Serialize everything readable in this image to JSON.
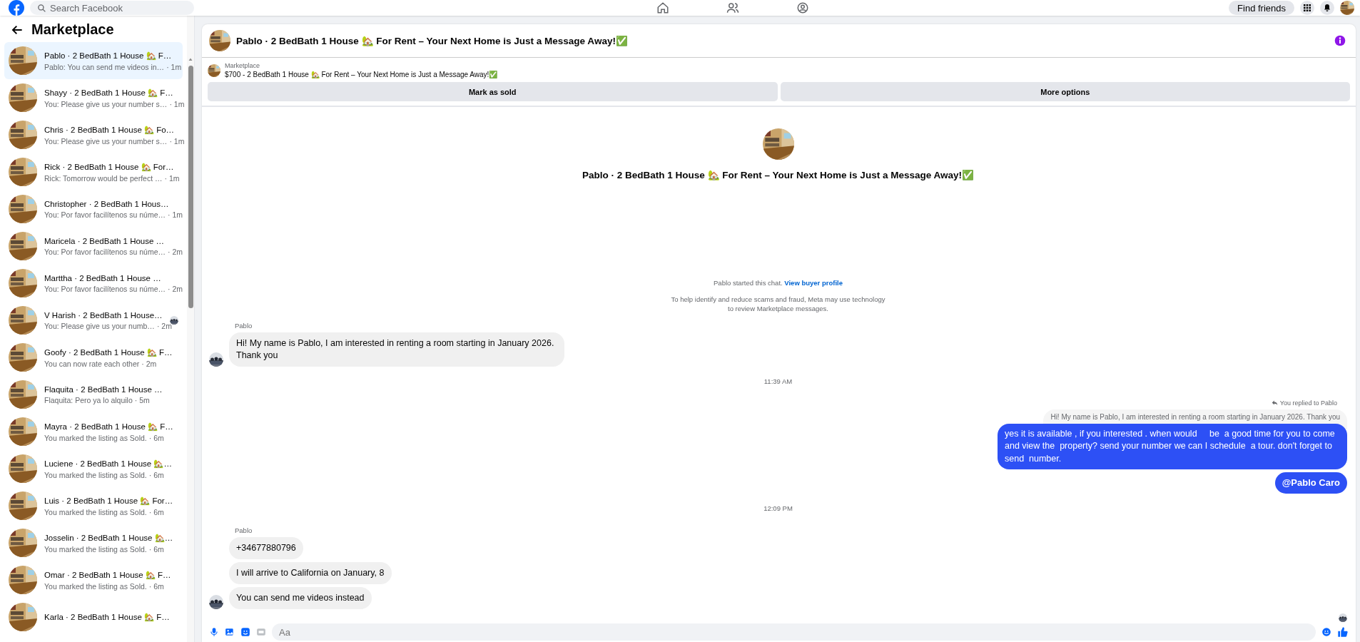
{
  "topbar": {
    "search": {
      "placeholder": "Search Facebook"
    },
    "find_friends": "Find friends"
  },
  "sidebar": {
    "title": "Marketplace",
    "conversations": [
      {
        "title": "Pablo · 2 BedBath 1 House 🏡 F…",
        "preview": "Pablo: You can send me videos in…",
        "time": "· 1m",
        "selected": true,
        "seen": false
      },
      {
        "title": "Shayy · 2 BedBath 1 House 🏡 F…",
        "preview": "You: Please give us your number s…",
        "time": "· 1m",
        "selected": false,
        "seen": false
      },
      {
        "title": "Chris · 2 BedBath 1 House 🏡 Fo…",
        "preview": "You: Please give us your number s…",
        "time": "· 1m",
        "selected": false,
        "seen": false
      },
      {
        "title": "Rick · 2 BedBath 1 House 🏡 For…",
        "preview": "Rick: Tomorrow would be perfect …",
        "time": "· 1m",
        "selected": false,
        "seen": false
      },
      {
        "title": "Christopher · 2 BedBath 1 Hous…",
        "preview": "You: Por favor facilítenos su núme…",
        "time": "· 1m",
        "selected": false,
        "seen": false
      },
      {
        "title": "Maricela · 2 BedBath 1 House …",
        "preview": "You: Por favor facilítenos su núme…",
        "time": "· 2m",
        "selected": false,
        "seen": false
      },
      {
        "title": "Marttha · 2 BedBath 1 House …",
        "preview": "You: Por favor facilítenos su núme…",
        "time": "· 2m",
        "selected": false,
        "seen": false
      },
      {
        "title": "V Harish · 2 BedBath 1 House…",
        "preview": "You: Please give us your numb…",
        "time": "· 2m",
        "selected": false,
        "seen": true
      },
      {
        "title": "Goofy · 2 BedBath 1 House 🏡 F…",
        "preview": "You can now rate each other",
        "time": "· 2m",
        "selected": false,
        "seen": false
      },
      {
        "title": "Flaquita · 2 BedBath 1 House …",
        "preview": "Flaquita: Pero ya lo alquilo",
        "time": "· 5m",
        "selected": false,
        "seen": false
      },
      {
        "title": "Mayra · 2 BedBath 1 House 🏡 F…",
        "preview": "You marked the listing as Sold.",
        "time": "· 6m",
        "selected": false,
        "seen": false
      },
      {
        "title": "Luciene · 2 BedBath 1 House 🏡…",
        "preview": "You marked the listing as Sold.",
        "time": "· 6m",
        "selected": false,
        "seen": false
      },
      {
        "title": "Luis · 2 BedBath 1 House 🏡 For…",
        "preview": "You marked the listing as Sold.",
        "time": "· 6m",
        "selected": false,
        "seen": false
      },
      {
        "title": "Josselin · 2 BedBath 1 House 🏡…",
        "preview": "You marked the listing as Sold.",
        "time": "· 6m",
        "selected": false,
        "seen": false
      },
      {
        "title": "Omar · 2 BedBath 1 House 🏡 F…",
        "preview": "You marked the listing as Sold.",
        "time": "· 6m",
        "selected": false,
        "seen": false
      },
      {
        "title": "Karla · 2 BedBath 1 House 🏡 F…",
        "selected": false,
        "seen": false
      }
    ]
  },
  "chat": {
    "title": "Pablo · 2 BedBath 1 House 🏡 For Rent – Your Next Home is Just a Message Away!✅",
    "listing": {
      "label": "Marketplace",
      "text": "$700 - 2 BedBath 1 House 🏡 For Rent – Your Next Home is Just a Message Away!✅",
      "buttons": [
        "Mark as sold",
        "More options"
      ]
    },
    "intro_title": "Pablo · 2 BedBath 1 House 🏡 For Rent – Your Next Home is Just a Message Away!✅",
    "messages": [
      {
        "kind": "system",
        "text": "Pablo started this chat.",
        "link": "View buyer profile"
      },
      {
        "kind": "notice",
        "text": "To help identify and reduce scams and fraud, Meta may use technology to review Marketplace messages."
      },
      {
        "kind": "incoming",
        "sender": "Pablo",
        "bubbles": [
          "Hi! My name is Pablo, I am interested in renting a room starting in January 2026. Thank you"
        ]
      },
      {
        "kind": "time",
        "text": "11:39 AM"
      },
      {
        "kind": "outgoing",
        "reply_label": "You replied to Pablo",
        "quoted": "Hi! My name is Pablo, I am interested in renting a room starting in January 2026. Thank you",
        "bubbles": [
          "yes it is available , if you interested . when would     be  a good time for you to come and view the  property? send your number we can I schedule  a tour. don't forget to send  number.",
          "@Pablo Caro"
        ]
      },
      {
        "kind": "time",
        "text": "12:09 PM"
      },
      {
        "kind": "incoming",
        "sender": "Pablo",
        "bubbles": [
          "+34677880796",
          "I will arrive to California on January, 8",
          "You can send me videos instead"
        ]
      }
    ],
    "composer": {
      "placeholder": "Aa"
    }
  }
}
